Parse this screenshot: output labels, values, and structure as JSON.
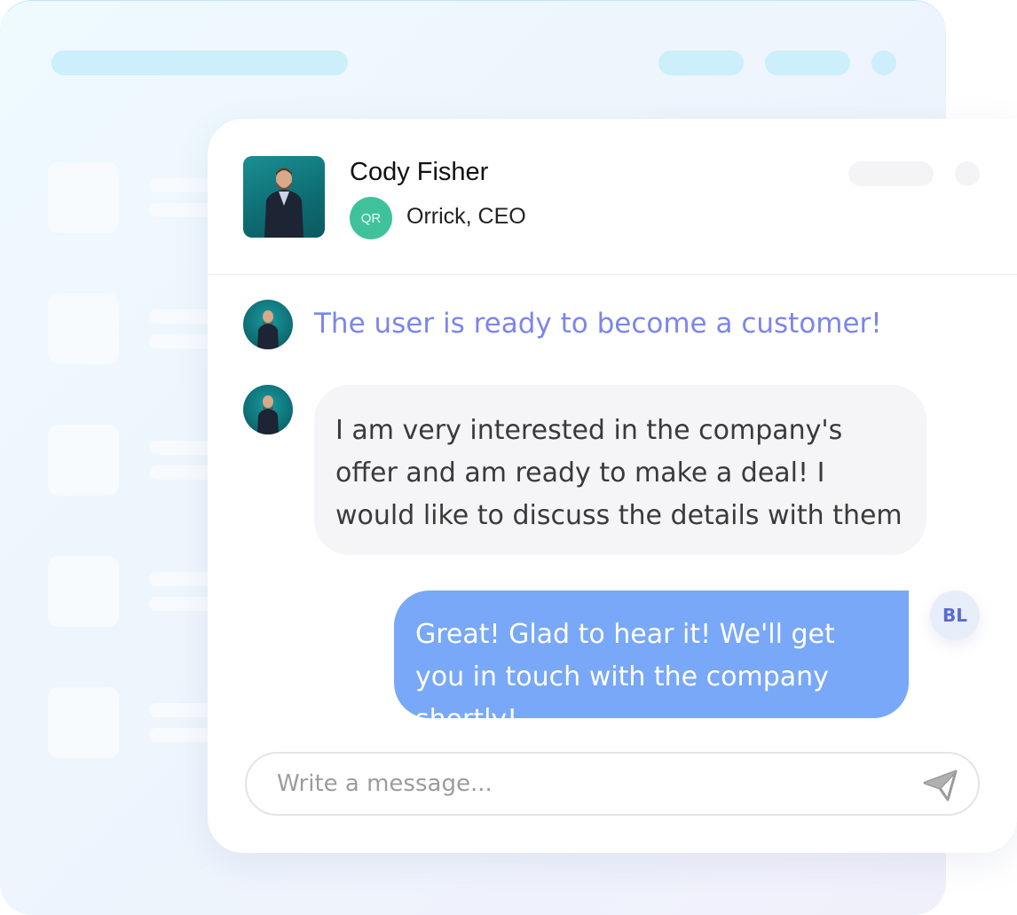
{
  "contact": {
    "name": "Cody Fisher",
    "company_badge": "QR",
    "role": "Orrick, CEO"
  },
  "messages": {
    "system_note": "The user is ready to become a customer!",
    "incoming": "I am very interested in the company's offer and am ready to make a deal! I would like to discuss the details with them",
    "outgoing": "Great! Glad to hear it! We'll get you in touch with the company shortly!",
    "agent_initials": "BL"
  },
  "composer": {
    "placeholder": "Write a message..."
  },
  "icons": {
    "send": "send-icon"
  },
  "colors": {
    "accent_blue": "#78a8f7",
    "system_note": "#7b86ec",
    "company_badge": "#3fc29c",
    "incoming_bubble": "#f5f5f7"
  }
}
